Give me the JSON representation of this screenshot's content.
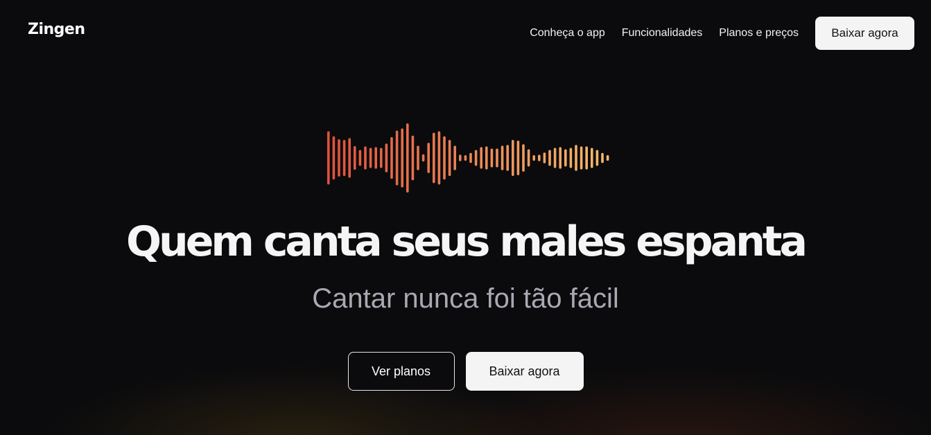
{
  "brand": {
    "logo_text": "Zingen"
  },
  "nav": {
    "links": [
      "Conheça o app",
      "Funcionalidades",
      "Planos e preços"
    ],
    "cta_label": "Baixar agora"
  },
  "hero": {
    "headline": "Quem canta seus males espanta",
    "subheadline": "Cantar nunca foi tão fácil",
    "primary_button": "Ver planos",
    "secondary_button": "Baixar agora"
  },
  "waveform": {
    "icon": "audio-waveform-icon",
    "gradient_start": "#e0503c",
    "gradient_end": "#f6be6e",
    "levels": [
      0.74,
      0.6,
      0.52,
      0.5,
      0.55,
      0.33,
      0.22,
      0.32,
      0.28,
      0.3,
      0.28,
      0.4,
      0.58,
      0.76,
      0.82,
      0.96,
      0.62,
      0.34,
      0.1,
      0.42,
      0.7,
      0.74,
      0.6,
      0.5,
      0.34,
      0.09,
      0.04,
      0.14,
      0.22,
      0.3,
      0.32,
      0.26,
      0.26,
      0.34,
      0.36,
      0.5,
      0.48,
      0.38,
      0.24,
      0.05,
      0.09,
      0.15,
      0.22,
      0.28,
      0.3,
      0.24,
      0.28,
      0.36,
      0.32,
      0.32,
      0.28,
      0.22,
      0.14,
      0.05
    ]
  },
  "colors": {
    "background": "#0b0b0d",
    "button_light": "#f4f4f4",
    "subheadline": "#a9a9b3"
  }
}
